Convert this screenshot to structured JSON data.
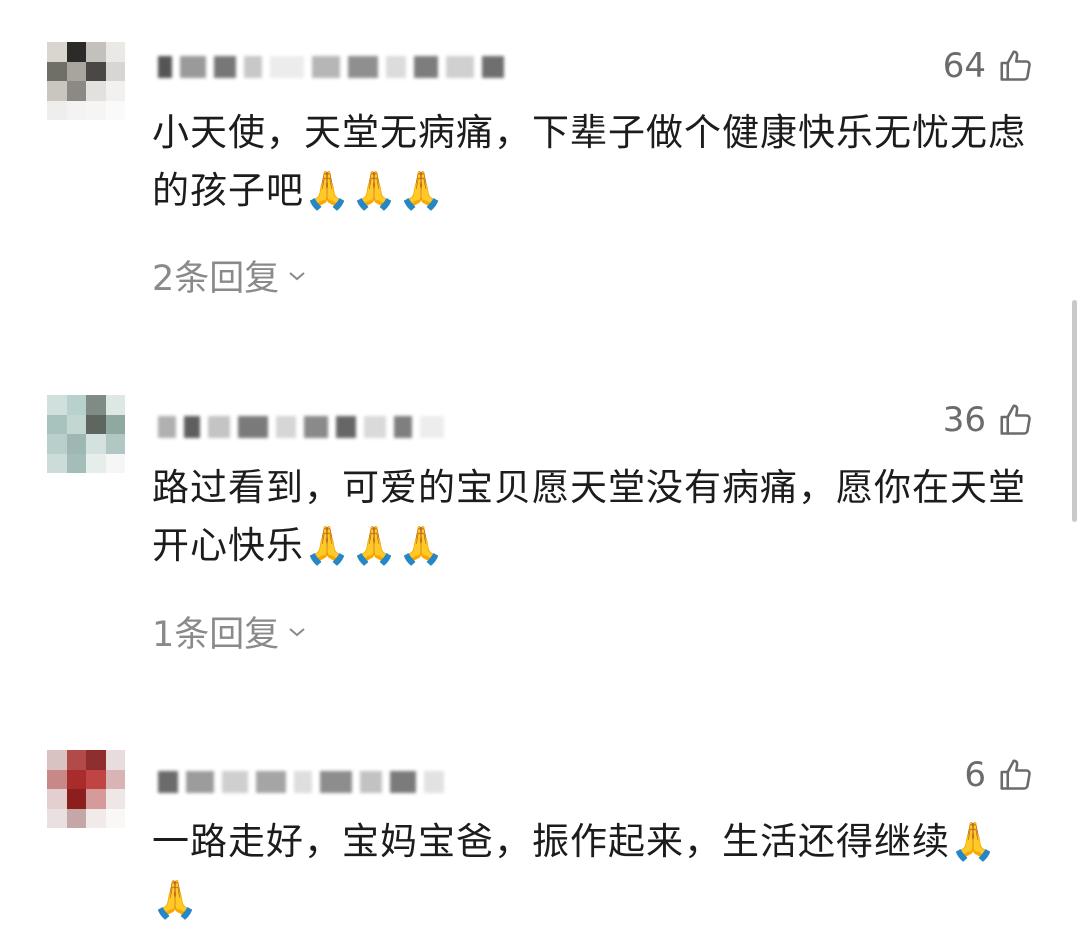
{
  "comments": [
    {
      "likes": "64",
      "text": "小天使，天堂无病痛，下辈子做个健康快乐无忧无虑的孩子吧🙏🙏🙏",
      "replies": "2条回复"
    },
    {
      "likes": "36",
      "text": "路过看到，可爱的宝贝愿天堂没有病痛，愿你在天堂开心快乐🙏🙏🙏",
      "replies": "1条回复"
    },
    {
      "likes": "6",
      "text": "一路走好，宝妈宝爸，振作起来，生活还得继续🙏🙏",
      "replies": ""
    }
  ],
  "icons": {
    "like": "thumbs-up-icon",
    "expand": "chevron-down-icon"
  },
  "colors": {
    "meta": "#8a8a8a",
    "text": "#1c1c1c"
  }
}
